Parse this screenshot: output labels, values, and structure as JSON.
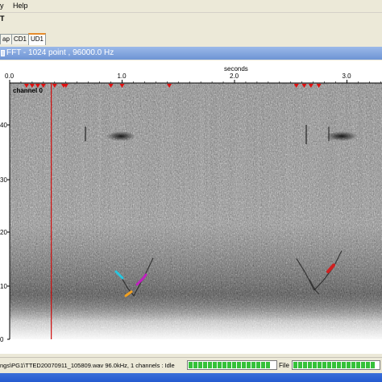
{
  "app": {
    "top_row": [
      {
        "label": "y"
      },
      {
        "label": "Help"
      }
    ],
    "menu_row": [
      {
        "label": "T"
      }
    ]
  },
  "tabs": [
    {
      "label": "ap",
      "active": false
    },
    {
      "label": "CD1",
      "active": false
    },
    {
      "label": "UD1",
      "active": true
    }
  ],
  "window": {
    "title": "FFT - 1024 point , 96000.0 Hz"
  },
  "spectrogram": {
    "x_axis_label": "seconds",
    "x_ticks": [
      {
        "value": 0.0,
        "label": "0.0"
      },
      {
        "value": 1.0,
        "label": "1.0"
      },
      {
        "value": 2.0,
        "label": "2.0"
      },
      {
        "value": 3.0,
        "label": "3.0"
      }
    ],
    "y_ticks": [
      {
        "value": 40,
        "label": "40"
      },
      {
        "value": 30,
        "label": "30"
      },
      {
        "value": 20,
        "label": "20"
      },
      {
        "value": 10,
        "label": "10"
      },
      {
        "value": 0,
        "label": "0"
      }
    ],
    "channel_label": "channel 0",
    "x_range": [
      0.0,
      3.25
    ],
    "y_range": [
      0,
      48
    ],
    "cursor_seconds": 0.37,
    "markers_seconds": [
      0.15,
      0.2,
      0.25,
      0.3,
      0.4,
      0.48,
      0.5,
      0.9,
      1.0,
      1.42,
      2.55,
      2.62,
      2.68,
      2.75
    ],
    "colors": {
      "cursor": "#d01010",
      "marker": "#e01010",
      "marks": [
        "#27c6e0",
        "#c020c0",
        "#f0a020",
        "#d02020"
      ]
    }
  },
  "status": {
    "text": "ngs\\PG1\\TTED20070911_105809.wav 96.0kHz, 1 channels : Idle",
    "left_label": "",
    "file_label": "File",
    "left_progress": 1.0,
    "file_progress": 1.0
  }
}
